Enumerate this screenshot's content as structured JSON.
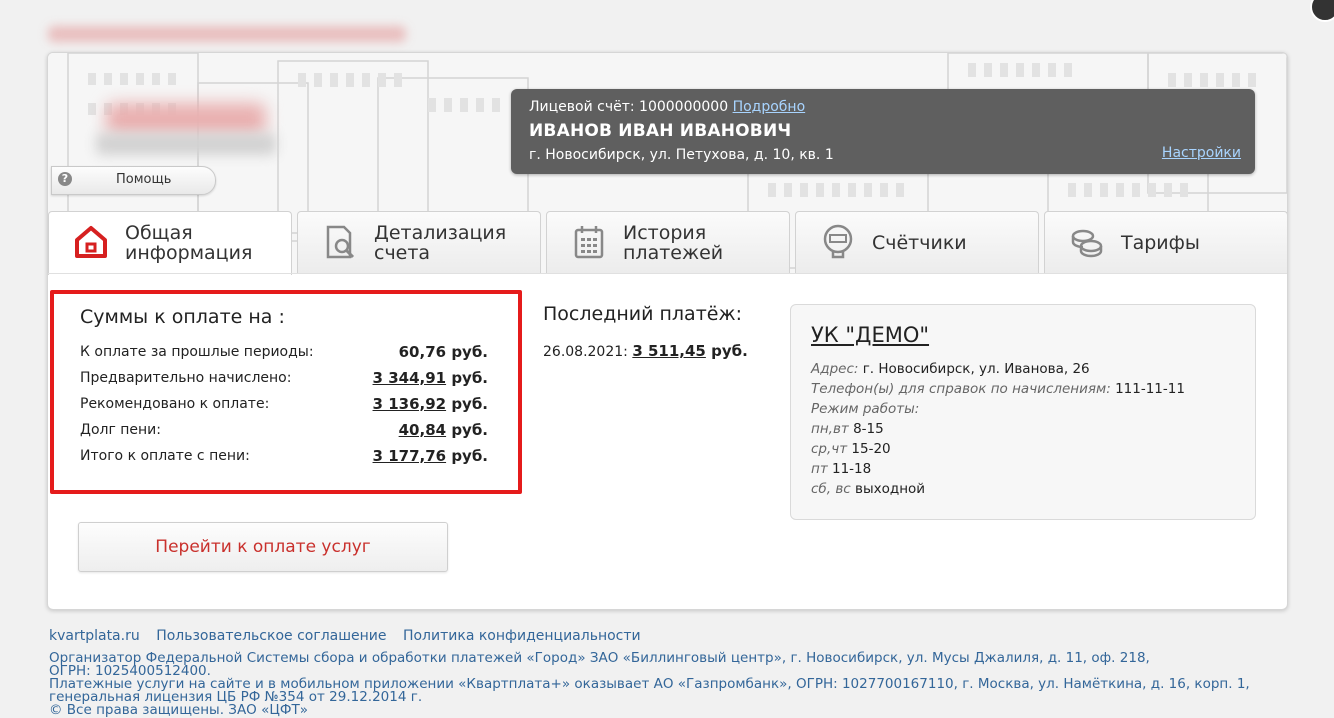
{
  "help": {
    "label": "Помощь"
  },
  "account": {
    "number_label": "Лицевой счёт: 1000000000",
    "details_link": "Подробно",
    "name": "ИВАНОВ ИВАН ИВАНОВИЧ",
    "address": "г. Новосибирск, ул. Петухова, д. 10, кв. 1",
    "settings_link": "Настройки"
  },
  "tabs": [
    {
      "line1": "Общая",
      "line2": "информация",
      "icon": "home-icon",
      "active": true
    },
    {
      "line1": "Детализация",
      "line2": "счета",
      "icon": "document-search-icon"
    },
    {
      "line1": "История",
      "line2": "платежей",
      "icon": "calendar-icon"
    },
    {
      "line1": "Счётчики",
      "line2": "",
      "icon": "meter-icon"
    },
    {
      "line1": "Тарифы",
      "line2": "",
      "icon": "coins-icon"
    }
  ],
  "sums": {
    "title": "Суммы к оплате на :",
    "rows": [
      {
        "label": "К оплате за прошлые периоды:",
        "value": "60,76",
        "unit": "руб."
      },
      {
        "label": "Предварительно начислено:",
        "value": "3 344,91",
        "unit": "руб."
      },
      {
        "label": "Рекомендовано к оплате:",
        "value": "3 136,92",
        "unit": "руб."
      },
      {
        "label": "Долг пени:",
        "value": "40,84",
        "unit": "руб."
      },
      {
        "label": "Итого к оплате с пени:",
        "value": "3 177,76",
        "unit": "руб."
      }
    ]
  },
  "last_payment": {
    "title": "Последний платёж:",
    "date": "26.08.2021:",
    "amount": "3 511,45",
    "unit": "руб."
  },
  "uk": {
    "title": "УК \"ДЕМО\"",
    "lines": [
      {
        "label": "Адрес:",
        "value": "г. Новосибирск, ул. Иванова, 26"
      },
      {
        "label": "Телефон(ы) для справок по начислениям:",
        "value": "111-11-11"
      },
      {
        "label": "Режим работы:",
        "value": ""
      },
      {
        "label": "пн,вт",
        "value": "8-15"
      },
      {
        "label": "ср,чт",
        "value": "15-20"
      },
      {
        "label": "пт",
        "value": "11-18"
      },
      {
        "label": "сб, вс",
        "value": "выходной"
      }
    ]
  },
  "pay_button": "Перейти к оплате услуг",
  "footer": {
    "links": [
      "kvartplata.ru",
      "Пользовательское соглашение",
      "Политика конфиденциальности"
    ],
    "text1": "Организатор Федеральной Системы сбора и обработки платежей «Город» ЗАО «Биллинговый центр», г. Новосибирск, ул. Мусы Джалиля, д. 11, оф. 218,",
    "text2": "ОГРН: 1025400512400.",
    "text3": "Платежные услуги на сайте и в мобильном приложении «Квартплата+» оказывает АО «Газпромбанк», ОГРН: 1027700167110, г. Москва, ул. Намёткина, д. 16, корп. 1,",
    "text4": "генеральная лицензия ЦБ РФ №354 от 29.12.2014 г.",
    "text5": "© Все права защищены. ЗАО «ЦФТ»"
  }
}
